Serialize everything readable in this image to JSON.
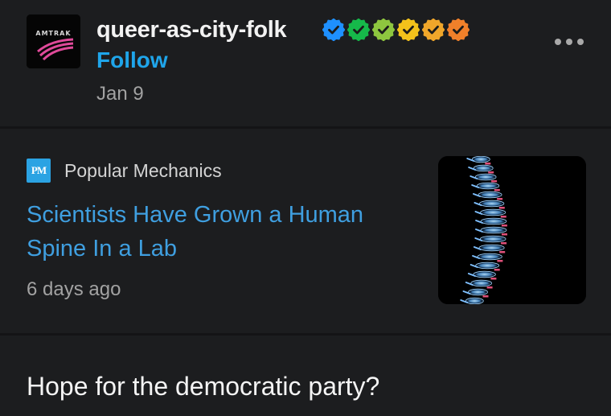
{
  "post": {
    "username": "queer-as-city-folk",
    "follow_label": "Follow",
    "date": "Jan 9",
    "avatar_text": "AMTRAK",
    "badges": [
      {
        "name": "verified-badge-blue",
        "color": "#1e90ff"
      },
      {
        "name": "verified-badge-green",
        "color": "#16b94a"
      },
      {
        "name": "verified-badge-lime",
        "color": "#8ec63f"
      },
      {
        "name": "verified-badge-yellow",
        "color": "#f3c21b"
      },
      {
        "name": "verified-badge-amber",
        "color": "#f0a62a"
      },
      {
        "name": "verified-badge-orange",
        "color": "#f0802a"
      }
    ],
    "more_icon": "ellipsis-icon"
  },
  "link_card": {
    "publisher_logo_text": "PM",
    "publisher": "Popular Mechanics",
    "headline": "Scientists Have Grown a Human Spine In a Lab",
    "age": "6 days ago",
    "thumbnail_icon": "spine-xray-image"
  },
  "body": {
    "text": "Hope for the democratic party?"
  },
  "colors": {
    "background": "#1c1d1f",
    "link": "#3f9fe0",
    "follow": "#1fa5ea",
    "muted": "#a2a2a2"
  }
}
